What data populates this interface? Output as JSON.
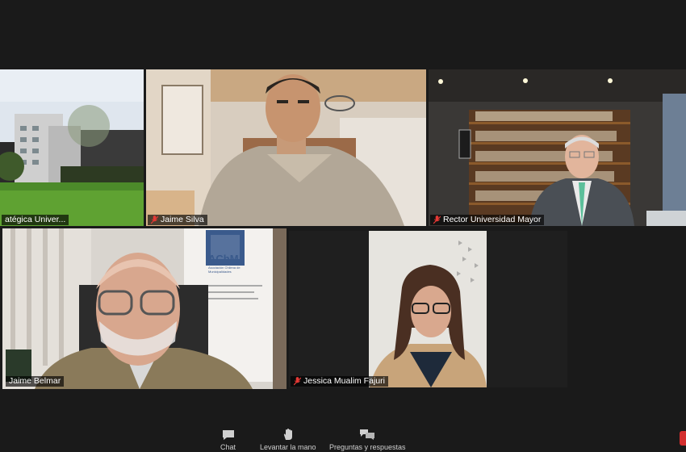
{
  "participants": [
    {
      "name": "atégica Univer...",
      "muted": false
    },
    {
      "name": "Jaime Silva",
      "muted": true
    },
    {
      "name": "Rector Universidad Mayor",
      "muted": true
    },
    {
      "name": "Jaime Belmar",
      "muted": false,
      "active_speaker": true
    },
    {
      "name": "Jessica Mualim Fajuri",
      "muted": true
    }
  ],
  "toolbar": {
    "chat_label": "Chat",
    "raise_hand_label": "Levantar la mano",
    "qa_label": "Preguntas y respuestas"
  },
  "banner": {
    "logo_text": "AChM",
    "subtitle": "Asociación Chilena de Municipalidades"
  },
  "colors": {
    "active_speaker_border": "#c5e35f",
    "muted_icon": "#e53935",
    "background": "#1a1a1a"
  }
}
